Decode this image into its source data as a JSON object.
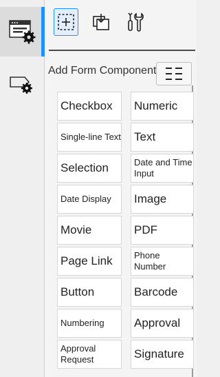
{
  "rail": {
    "items": [
      {
        "icon": "window-gear-icon",
        "active": true
      },
      {
        "icon": "tag-gear-icon",
        "active": false
      }
    ]
  },
  "toolbar": {
    "tools": [
      {
        "icon": "add-field-icon",
        "selected": true
      },
      {
        "icon": "layers-icon",
        "selected": false
      },
      {
        "icon": "tools-icon",
        "selected": false
      }
    ]
  },
  "section": {
    "title": "Add Form Components",
    "view_toggle_icon": "list-view-icon"
  },
  "components": [
    {
      "label": "Checkbox",
      "size": "big"
    },
    {
      "label": "Numeric",
      "size": "big"
    },
    {
      "label": "Single-line Text",
      "size": "small"
    },
    {
      "label": "Text",
      "size": "big"
    },
    {
      "label": "Selection",
      "size": "big"
    },
    {
      "label": "Date and Time Input",
      "size": "small"
    },
    {
      "label": "Date Display",
      "size": "small"
    },
    {
      "label": "Image",
      "size": "big"
    },
    {
      "label": "Movie",
      "size": "big"
    },
    {
      "label": "PDF",
      "size": "big"
    },
    {
      "label": "Page Link",
      "size": "big"
    },
    {
      "label": "Phone Number",
      "size": "small"
    },
    {
      "label": "Button",
      "size": "big"
    },
    {
      "label": "Barcode",
      "size": "big"
    },
    {
      "label": "Numbering",
      "size": "small"
    },
    {
      "label": "Approval",
      "size": "big"
    },
    {
      "label": "Approval Request",
      "size": "small"
    },
    {
      "label": "Signature",
      "size": "big"
    }
  ],
  "colors": {
    "accent": "#1e90ff",
    "toolbar_line": "#4a4a4a"
  }
}
